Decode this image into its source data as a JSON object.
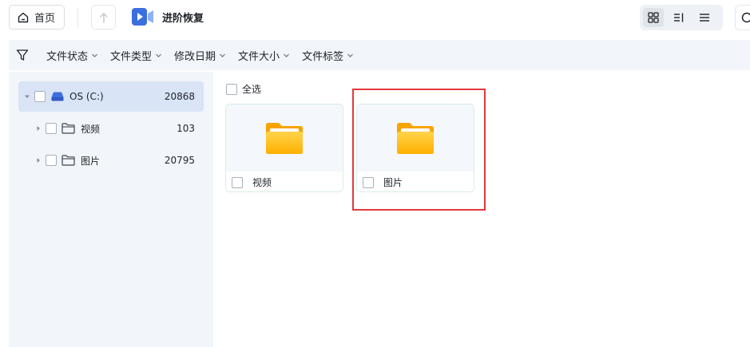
{
  "topbar": {
    "home_label": "首页",
    "title": "进阶恢复"
  },
  "filters": [
    {
      "label": "文件状态"
    },
    {
      "label": "文件类型"
    },
    {
      "label": "修改日期"
    },
    {
      "label": "文件大小"
    },
    {
      "label": "文件标签"
    }
  ],
  "tree": {
    "drive": {
      "label": "OS (C:)",
      "count": "20868"
    },
    "folders": [
      {
        "label": "视频",
        "count": "103"
      },
      {
        "label": "图片",
        "count": "20795"
      }
    ]
  },
  "main": {
    "select_all": "全选",
    "cards": [
      {
        "label": "视频"
      },
      {
        "label": "图片"
      }
    ]
  },
  "colors": {
    "accent": "#3b6fe0",
    "folder_yellow": "#ffc21a",
    "highlight": "#e2393c"
  }
}
